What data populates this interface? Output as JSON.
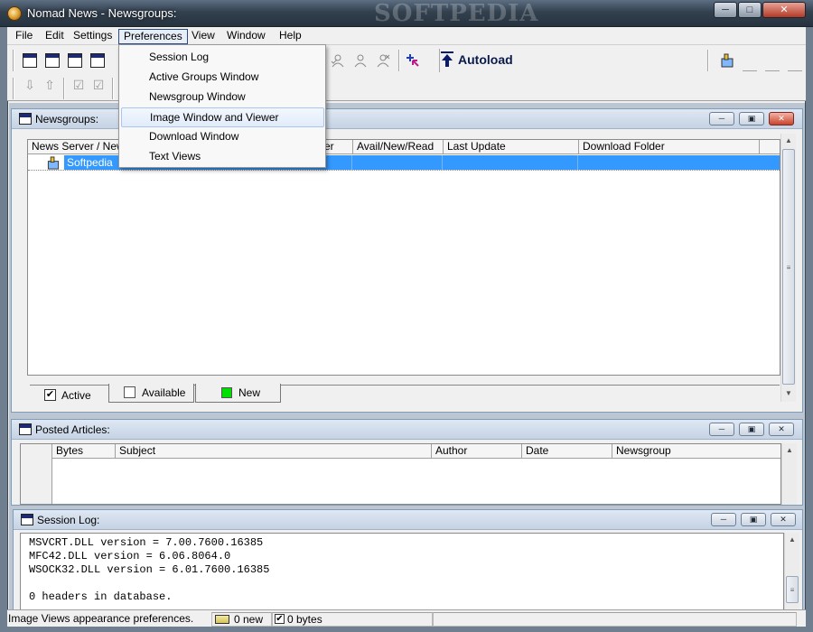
{
  "window": {
    "title": "Nomad News - Newsgroups:",
    "watermark": "SOFTPEDIA",
    "controls": {
      "minimize": "─",
      "maximize": "□",
      "close": "✕"
    }
  },
  "menu": {
    "items": [
      "File",
      "Edit",
      "Settings",
      "Preferences",
      "View",
      "Window",
      "Help"
    ],
    "active": "Preferences"
  },
  "preferences_menu": {
    "items": [
      "Session Log",
      "Active Groups Window",
      "Newsgroup Window",
      "Image Window and Viewer",
      "Download Window",
      "Text Views"
    ],
    "highlighted": "Image Window and Viewer"
  },
  "toolbar": {
    "autoload_label": "Autoload"
  },
  "newsgroups_window": {
    "caption": "Newsgroups:",
    "columns": [
      "News Server / Newsgroup",
      "Filter",
      "Avail/New/Read",
      "Last Update",
      "Download Folder"
    ],
    "rows": [
      {
        "name": "Softpedia",
        "selected": true
      }
    ],
    "tabs": [
      {
        "label": "Active",
        "checked": true
      },
      {
        "label": "Available",
        "checked": false
      },
      {
        "label": "New",
        "color": "#00e000"
      }
    ]
  },
  "posted_articles_window": {
    "caption": "Posted Articles:",
    "columns": [
      "Bytes",
      "Subject",
      "Author",
      "Date",
      "Newsgroup"
    ]
  },
  "session_log_window": {
    "caption": "Session Log:",
    "lines": [
      "MSVCRT.DLL version = 7.00.7600.16385",
      "MFC42.DLL version = 6.06.8064.0",
      "WSOCK32.DLL version = 6.01.7600.16385",
      "",
      "0 headers in database."
    ]
  },
  "statusbar": {
    "message": "Image Views appearance preferences.",
    "new_count": "0 new",
    "bytes": "0 bytes"
  },
  "colors": {
    "selection": "#3399ff",
    "new_indicator": "#00e000"
  }
}
